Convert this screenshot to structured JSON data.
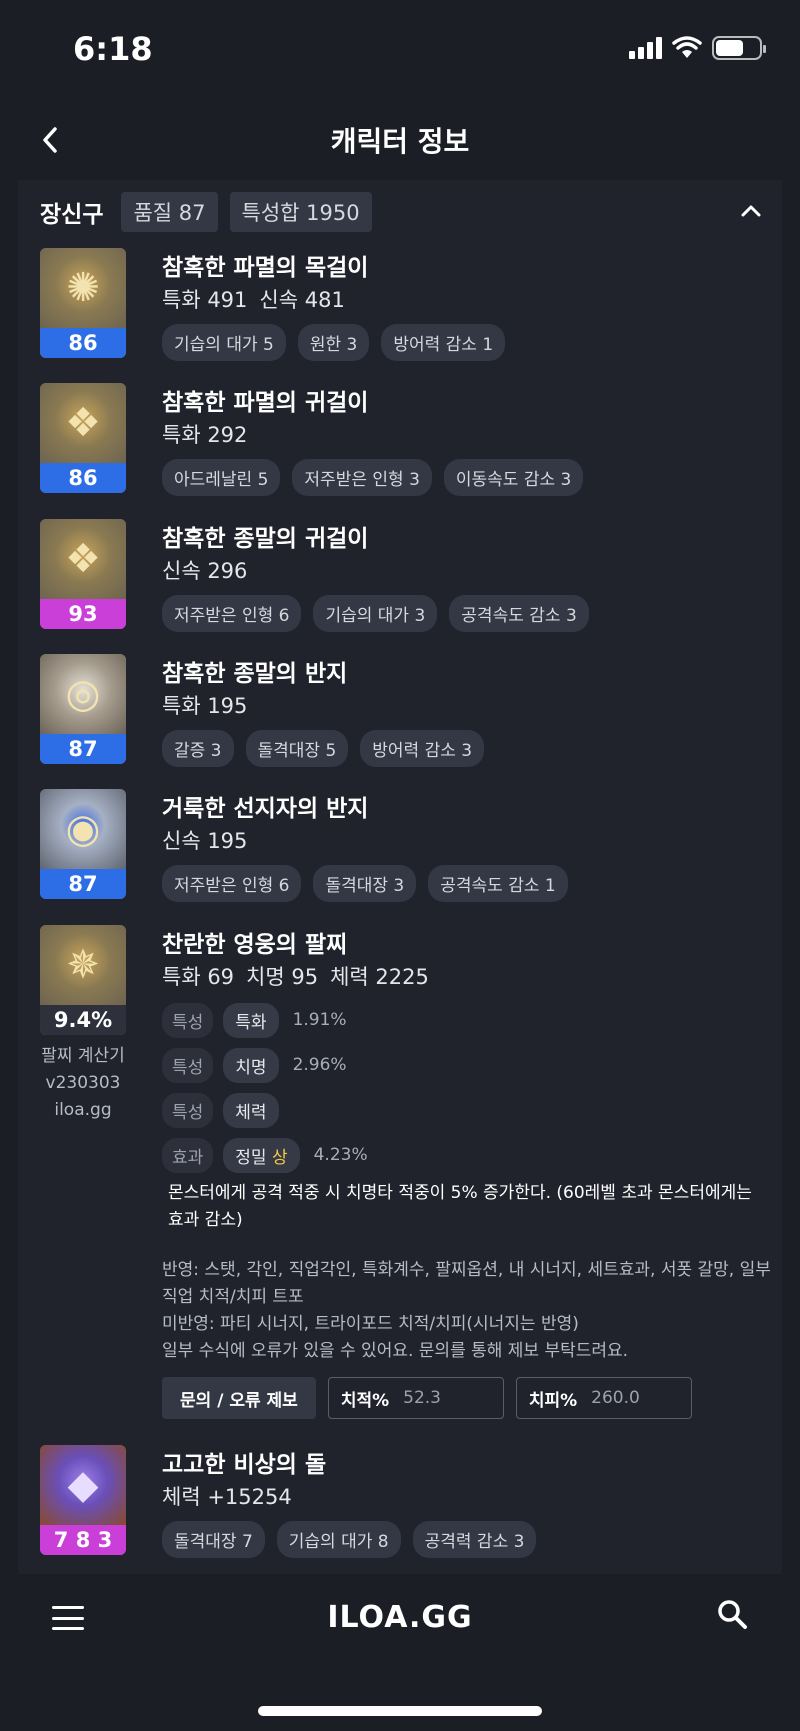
{
  "status": {
    "time": "6:18"
  },
  "header": {
    "title": "캐릭터 정보"
  },
  "section": {
    "title": "장신구",
    "quality": "품질 87",
    "trait_sum": "특성합 1950"
  },
  "items": [
    {
      "name": "참혹한 파멸의 목걸이",
      "level": "86",
      "stats": [
        "특화 491",
        "신속 481"
      ],
      "engravings": [
        "기습의 대가 5",
        "원한 3",
        "방어력 감소 1"
      ]
    },
    {
      "name": "참혹한 파멸의 귀걸이",
      "level": "86",
      "stats": [
        "특화 292"
      ],
      "engravings": [
        "아드레날린 5",
        "저주받은 인형 3",
        "이동속도 감소 3"
      ]
    },
    {
      "name": "참혹한 종말의 귀걸이",
      "level": "93",
      "stats": [
        "신속 296"
      ],
      "engravings": [
        "저주받은 인형 6",
        "기습의 대가 3",
        "공격속도 감소 3"
      ]
    },
    {
      "name": "참혹한 종말의 반지",
      "level": "87",
      "stats": [
        "특화 195"
      ],
      "engravings": [
        "갈증 3",
        "돌격대장 5",
        "방어력 감소 3"
      ]
    },
    {
      "name": "거룩한 선지자의 반지",
      "level": "87",
      "stats": [
        "신속 195"
      ],
      "engravings": [
        "저주받은 인형 6",
        "돌격대장 3",
        "공격속도 감소 1"
      ]
    }
  ],
  "bracelet": {
    "name": "찬란한 영웅의 팔찌",
    "stats": [
      "특화 69",
      "치명 95",
      "체력 2225"
    ],
    "score": "9.4%",
    "calc_name": "팔찌 계산기",
    "calc_version": "v230303",
    "calc_site": "iloa.gg",
    "rows": [
      {
        "type": "특성",
        "name": "특화",
        "grade": "",
        "pct": "1.91%"
      },
      {
        "type": "특성",
        "name": "치명",
        "grade": "",
        "pct": "2.96%"
      },
      {
        "type": "특성",
        "name": "체력",
        "grade": "",
        "pct": ""
      },
      {
        "type": "효과",
        "name": "정밀",
        "grade": "상",
        "pct": "4.23%"
      }
    ],
    "effect_text": "몬스터에게 공격 적중 시 치명타 적중이 5% 증가한다. (60레벨 초과 몬스터에게는 효과 감소)",
    "note1": "반영: 스탯, 각인, 직업각인, 특화계수, 팔찌옵션, 내 시너지, 세트효과, 서폿 갈망, 일부 직업 치적/치피 트포",
    "note2": "미반영: 파티 시너지, 트라이포드 치적/치피(시너지는 반영)",
    "note3": "일부 수식에 오류가 있을 수 있어요. 문의를 통해 제보 부탁드려요.",
    "report_button": "문의 / 오류 제보",
    "crit_label": "치적%",
    "crit_value": "52.3",
    "critdmg_label": "치피%",
    "critdmg_value": "260.0"
  },
  "stone": {
    "name": "고고한 비상의 돌",
    "level": "7 8 3",
    "stats": [
      "체력 +15254"
    ],
    "engravings": [
      "돌격대장 7",
      "기습의 대가 8",
      "공격력 감소 3"
    ]
  },
  "bottom": {
    "brand": "ILOA.GG"
  },
  "colors": {
    "level_blue": "#2d6ee6",
    "level_purple": "#c93fd8",
    "grade_gold": "#f2c948"
  }
}
